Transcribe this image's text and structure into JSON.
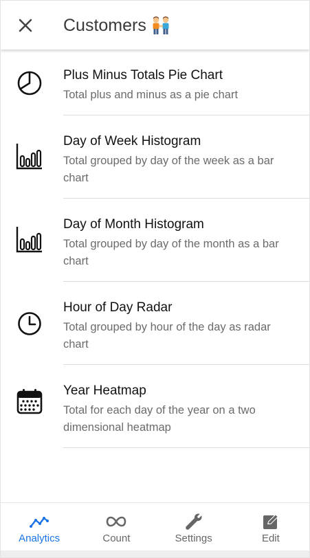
{
  "header": {
    "title": "Customers",
    "title_emoji": "🧑‍🤝‍🧑"
  },
  "items": [
    {
      "title": "Plus Minus Totals Pie Chart",
      "subtitle": "Total plus and minus as a pie chart",
      "icon": "pie-chart-icon"
    },
    {
      "title": "Day of Week Histogram",
      "subtitle": "Total grouped by day of the week as a bar chart",
      "icon": "bar-chart-icon"
    },
    {
      "title": "Day of Month Histogram",
      "subtitle": "Total grouped by day of the month as a bar chart",
      "icon": "bar-chart-icon"
    },
    {
      "title": "Hour of Day Radar",
      "subtitle": "Total grouped by hour of the day as radar chart",
      "icon": "clock-icon"
    },
    {
      "title": "Year Heatmap",
      "subtitle": "Total for each day of the year on a two dimensional heatmap",
      "icon": "calendar-icon"
    }
  ],
  "nav": [
    {
      "label": "Analytics",
      "icon": "analytics-icon",
      "active": true
    },
    {
      "label": "Count",
      "icon": "infinity-icon",
      "active": false
    },
    {
      "label": "Settings",
      "icon": "wrench-icon",
      "active": false
    },
    {
      "label": "Edit",
      "icon": "edit-icon",
      "active": false
    }
  ],
  "colors": {
    "accent": "#1a73e8",
    "text_primary": "#111111",
    "text_secondary": "#6b6b6b",
    "nav_inactive": "#666666"
  }
}
